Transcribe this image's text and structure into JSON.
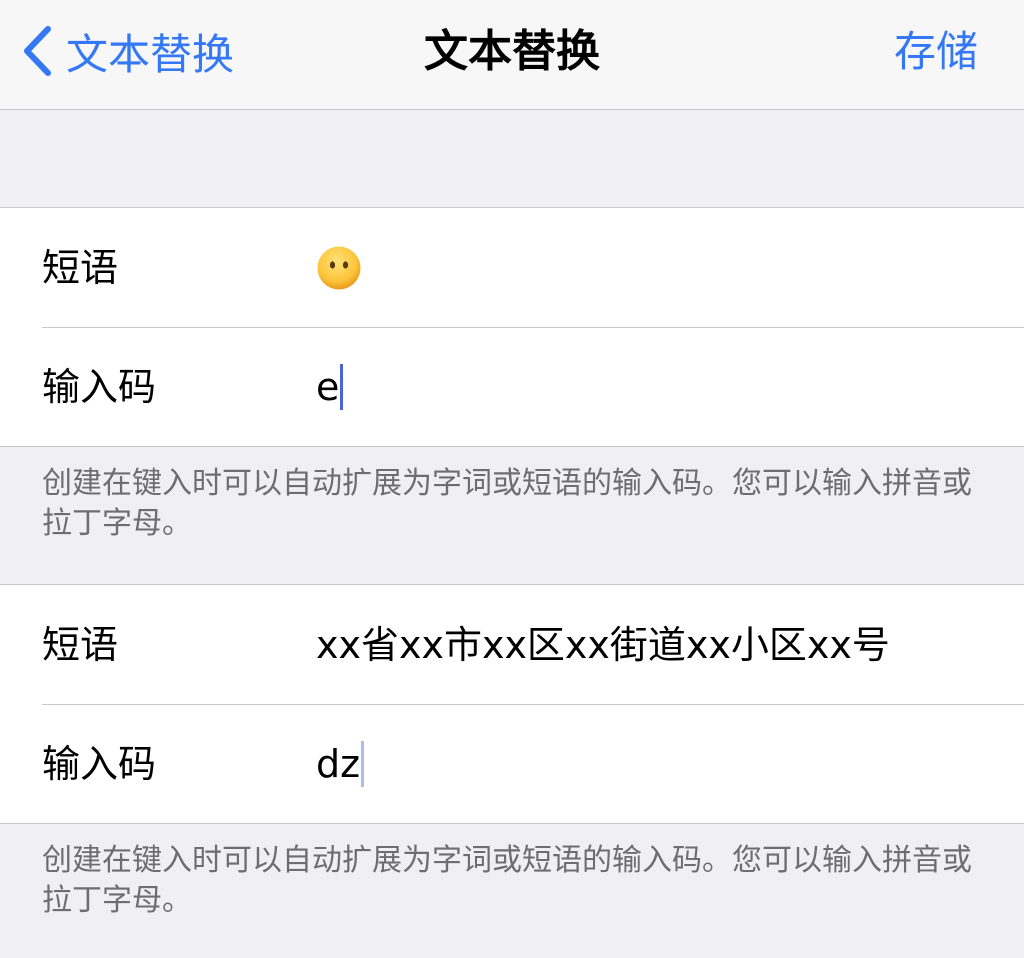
{
  "nav": {
    "back_label": "文本替换",
    "title": "文本替换",
    "save_label": "存储",
    "accent_color": "#3478f6"
  },
  "entries": [
    {
      "phrase_label": "短语",
      "phrase_value": "",
      "phrase_icon": "neutral-face-emoji-icon",
      "shortcut_label": "输入码",
      "shortcut_value": "e"
    },
    {
      "phrase_label": "短语",
      "phrase_value": "xx省xx市xx区xx街道xx小区xx号",
      "shortcut_label": "输入码",
      "shortcut_value": "dz"
    }
  ],
  "footer_note": "创建在键入时可以自动扩展为字词或短语的输入码。您可以输入拼音或拉丁字母。"
}
